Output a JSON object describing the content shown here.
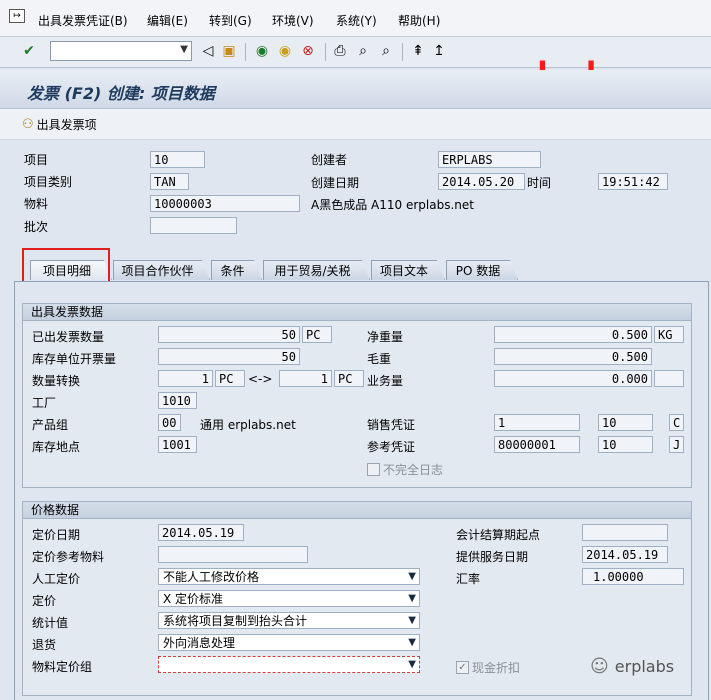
{
  "menubar": {
    "items": [
      "出具发票凭证(B)",
      "编辑(E)",
      "转到(G)",
      "环境(V)",
      "系统(Y)",
      "帮助(H)"
    ]
  },
  "toolbar": {
    "watermark": "erplabs"
  },
  "title": "发票 (F2) 创建: 项目数据",
  "app_toolbar": {
    "issue_item_label": "出具发票项"
  },
  "header": {
    "item_label": "项目",
    "item_value": "10",
    "item_category_label": "项目类别",
    "item_category_value": "TAN",
    "material_label": "物料",
    "material_value": "10000003",
    "material_desc": "A黑色成品 A110 erplabs.net",
    "batch_label": "批次",
    "batch_value": "",
    "created_by_label": "创建者",
    "created_by_value": "ERPLABS",
    "created_on_label": "创建日期",
    "created_on_value": "2014.05.20",
    "time_label": "时间",
    "time_value": "19:51:42"
  },
  "tabs": [
    "项目明细",
    "项目合作伙伴",
    "条件",
    "用于贸易/关税",
    "项目文本",
    "PO 数据"
  ],
  "billing": {
    "group_title": "出具发票数据",
    "billed_qty_label": "已出发票数量",
    "billed_qty_value": "50",
    "billed_qty_unit": "PC",
    "stock_qty_label": "库存单位开票量",
    "stock_qty_value": "50",
    "conversion_label": "数量转换",
    "conv_left_value": "1",
    "conv_left_unit": "PC",
    "conv_arrow": "<->",
    "conv_right_value": "1",
    "conv_right_unit": "PC",
    "plant_label": "工厂",
    "plant_value": "1010",
    "product_group_label": "产品组",
    "product_group_value": "00",
    "product_group_desc": "通用 erplabs.net",
    "storage_label": "库存地点",
    "storage_value": "1001",
    "net_weight_label": "净重量",
    "net_weight_value": "0.500",
    "net_weight_unit": "KG",
    "gross_weight_label": "毛重",
    "gross_weight_value": "0.500",
    "volume_label": "业务量",
    "volume_value": "0.000",
    "volume_unit": "",
    "sales_doc_label": "销售凭证",
    "sales_doc_value": "1",
    "sales_doc_item": "10",
    "sales_doc_cat": "C",
    "ref_doc_label": "参考凭证",
    "ref_doc_value": "80000001",
    "ref_doc_item": "10",
    "ref_doc_cat": "J",
    "incomplete_log_label": "不完全日志"
  },
  "pricing": {
    "group_title": "价格数据",
    "pricing_date_label": "定价日期",
    "pricing_date_value": "2014.05.19",
    "pricing_ref_material_label": "定价参考物料",
    "pricing_ref_material_value": "",
    "manual_pricing_label": "人工定价",
    "manual_pricing_value": "不能人工修改价格",
    "pricing_label": "定价",
    "pricing_value": "X 定价标准",
    "statistical_label": "统计值",
    "statistical_value": "系统将项目复制到抬头合计",
    "returns_label": "退货",
    "returns_value": "外向消息处理",
    "material_price_group_label": "物料定价组",
    "material_price_group_value": "",
    "settlement_start_label": "会计结算期起点",
    "settlement_start_value": "",
    "service_date_label": "提供服务日期",
    "service_date_value": "2014.05.19",
    "exchange_rate_label": "汇率",
    "exchange_rate_value": "1.00000",
    "cash_discount_label": "现金折扣"
  },
  "wechat": {
    "label": "erplabs"
  }
}
